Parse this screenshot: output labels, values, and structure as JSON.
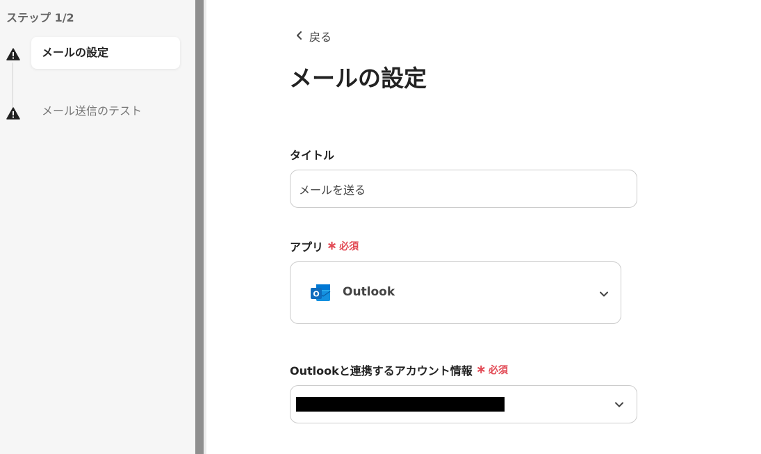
{
  "sidebar": {
    "step_counter": "ステップ 1/2",
    "steps": [
      {
        "label": "メールの設定",
        "state": "active",
        "icon": "warning-icon"
      },
      {
        "label": "メール送信のテスト",
        "state": "inactive",
        "icon": "warning-icon"
      }
    ]
  },
  "main": {
    "back_label": "戻る",
    "page_title": "メールの設定",
    "fields": {
      "title": {
        "label": "タイトル",
        "value": "メールを送る"
      },
      "app": {
        "label": "アプリ",
        "required_label": "必須",
        "selected_value": "Outlook",
        "icon": "outlook-icon"
      },
      "account": {
        "label": "Outlookと連携するアカウント情報",
        "required_label": "必須"
      }
    }
  },
  "colors": {
    "sidebar_bg": "#f6f6f6",
    "required": "#e24a55",
    "outlook_blue": "#0f6cbd",
    "warning": "#222222"
  }
}
